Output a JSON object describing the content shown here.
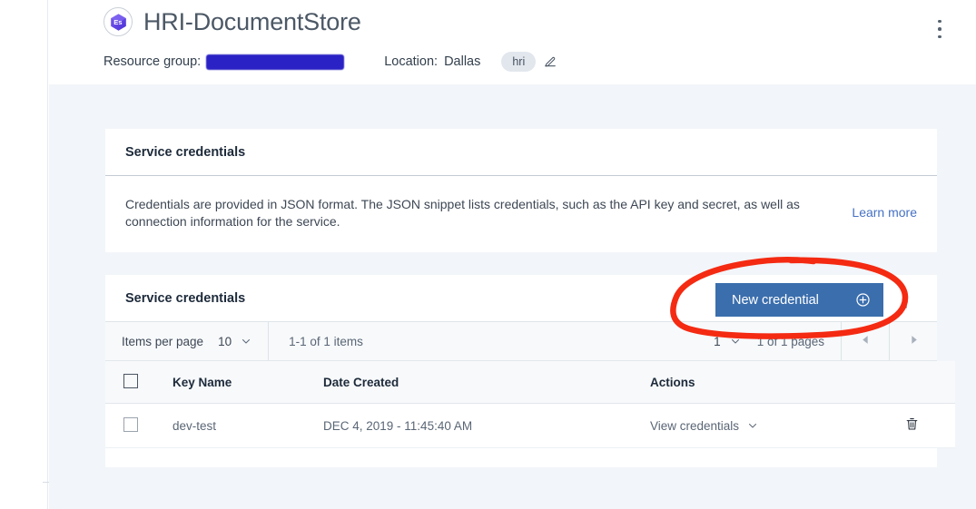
{
  "header": {
    "service_icon_label": "Es",
    "title": "HRI-DocumentStore",
    "resource_group_label": "Resource group:",
    "resource_group_value_redacted": "",
    "location_label": "Location:",
    "location_value": "Dallas",
    "tag": "hri",
    "edit_icon": "pencil-icon",
    "overflow_icon": "overflow-vertical-icon"
  },
  "info_card": {
    "title": "Service credentials",
    "description": "Credentials are provided in JSON format. The JSON snippet lists credentials, such as the API key and secret, as well as connection information for the service.",
    "learn_more": "Learn more"
  },
  "credentials_card": {
    "title": "Service credentials",
    "new_credential_label": "New credential",
    "new_credential_icon": "plus-circle-icon",
    "overflow_icon": "overflow-vertical-icon",
    "pagination": {
      "items_per_page_label": "Items per page",
      "items_per_page_value": "10",
      "range_text": "1-1 of 1 items",
      "page_value": "1",
      "pages_text": "1 of 1 pages",
      "prev_icon": "caret-left-icon",
      "next_icon": "caret-right-icon"
    },
    "table": {
      "columns": [
        "Key Name",
        "Date Created",
        "Actions"
      ],
      "rows": [
        {
          "key_name": "dev-test",
          "date_created": "DEC 4, 2019 - 11:45:40 AM",
          "action_label": "View credentials",
          "action_icon": "chevron-down-icon",
          "delete_icon": "trash-icon"
        }
      ]
    }
  },
  "annotation": {
    "shape": "red-ellipse-highlight",
    "color": "#f42a12",
    "target": "New credential"
  },
  "colors": {
    "primary_button": "#3b6ead",
    "link": "#4571c4",
    "page_background": "#f2f5f9",
    "redaction": "#2a22c4",
    "annotation_red": "#f42a12"
  }
}
